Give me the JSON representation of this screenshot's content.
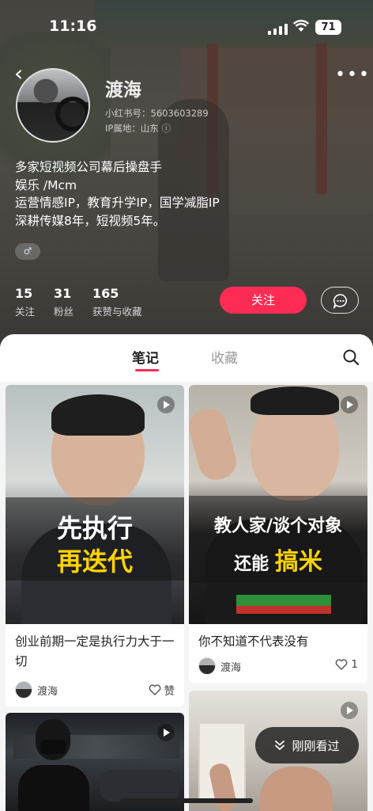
{
  "status_bar": {
    "time": "11:16",
    "battery": "71"
  },
  "profile": {
    "name": "渡海",
    "red_id": "小红书号：5603603289",
    "ip_location": "IP属地：山东",
    "bio_lines": [
      "多家短视频公司幕后操盘手",
      "娱乐 /Mcm",
      "运营情感IP，教育升学IP，国学减脂IP",
      "深耕传媒8年，短视频5年。"
    ],
    "gender_symbol": "♂"
  },
  "stats": [
    {
      "num": "15",
      "label": "关注"
    },
    {
      "num": "31",
      "label": "粉丝"
    },
    {
      "num": "165",
      "label": "获赞与收藏"
    }
  ],
  "actions": {
    "follow": "关注"
  },
  "tabs": {
    "notes": "笔记",
    "collections": "收藏"
  },
  "cards": [
    {
      "caption_top": "先执行",
      "caption_bottom": "再迭代",
      "title": "创业前期一定是执行力大于一切",
      "author": "渡海",
      "likes": "赞"
    },
    {
      "caption_top": "教人家/谈个对象",
      "caption_bottom_prefix": "还能",
      "caption_bottom": "搞米",
      "title": "你不知道不代表没有",
      "author": "渡海",
      "likes": "1"
    }
  ],
  "floating": {
    "recent": "刚刚看过"
  },
  "colors": {
    "accent": "#fe2c55",
    "caption_yellow": "#ffd400"
  }
}
